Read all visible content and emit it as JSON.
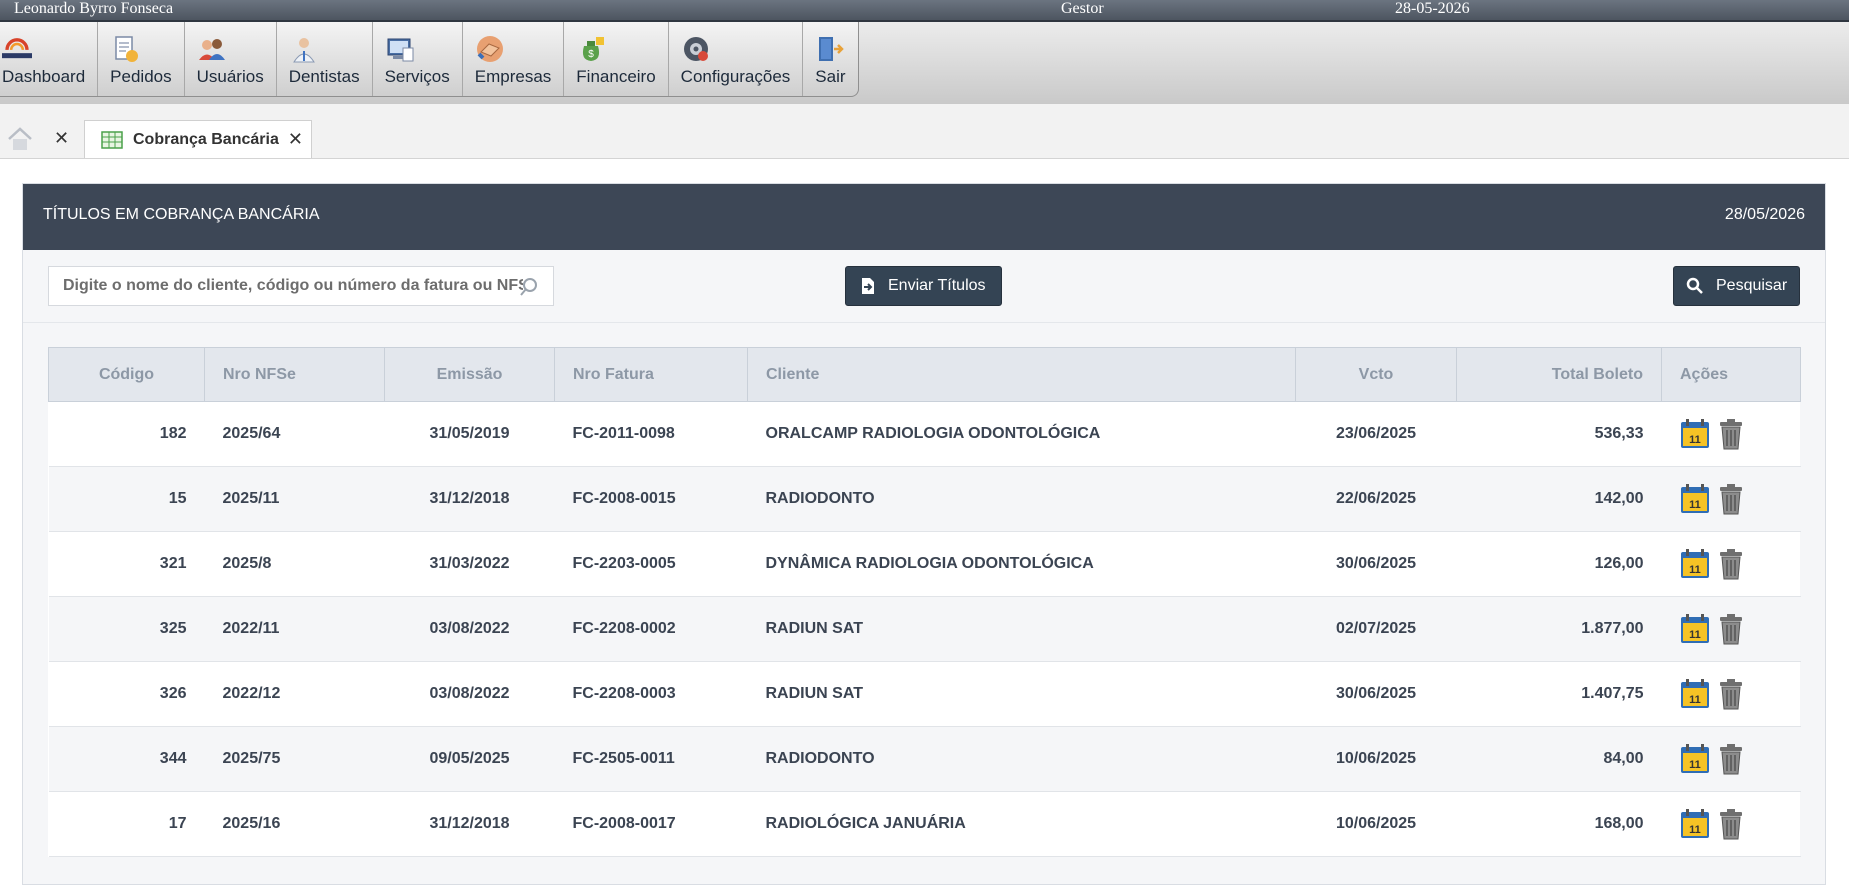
{
  "topbar": {
    "user": "Leonardo Byrro Fonseca",
    "role": "Gestor",
    "date": "28-05-2026"
  },
  "menu": [
    {
      "label": "Dashboard",
      "icon": "diagnosis-logo-icon"
    },
    {
      "label": "Pedidos",
      "icon": "orders-icon"
    },
    {
      "label": "Usuários",
      "icon": "users-icon"
    },
    {
      "label": "Dentistas",
      "icon": "dentist-icon"
    },
    {
      "label": "Serviços",
      "icon": "services-icon"
    },
    {
      "label": "Empresas",
      "icon": "handshake-icon"
    },
    {
      "label": "Financeiro",
      "icon": "money-bag-icon"
    },
    {
      "label": "Configurações",
      "icon": "settings-icon"
    },
    {
      "label": "Sair",
      "icon": "exit-door-icon"
    }
  ],
  "tabs": {
    "active_label": "Cobrança Bancária"
  },
  "panel": {
    "title": "TÍTULOS EM COBRANÇA BANCÁRIA",
    "date": "28/05/2026",
    "search_placeholder": "Digite o nome do cliente, código ou número da fatura ou NFSe",
    "send_label": "Enviar Títulos",
    "search_label": "Pesquisar"
  },
  "table": {
    "headers": [
      "Código",
      "Nro NFSe",
      "Emissão",
      "Nro Fatura",
      "Cliente",
      "Vcto",
      "Total Boleto",
      "Ações"
    ],
    "rows": [
      {
        "codigo": "182",
        "nfse": "2025/64",
        "emissao": "31/05/2019",
        "fatura": "FC-2011-0098",
        "cliente": "ORALCAMP RADIOLOGIA ODONTOLÓGICA",
        "vcto": "23/06/2025",
        "total": "536,33"
      },
      {
        "codigo": "15",
        "nfse": "2025/11",
        "emissao": "31/12/2018",
        "fatura": "FC-2008-0015",
        "cliente": "RADIODONTO",
        "vcto": "22/06/2025",
        "total": "142,00"
      },
      {
        "codigo": "321",
        "nfse": "2025/8",
        "emissao": "31/03/2022",
        "fatura": "FC-2203-0005",
        "cliente": "DYNÂMICA RADIOLOGIA ODONTOLÓGICA",
        "vcto": "30/06/2025",
        "total": "126,00"
      },
      {
        "codigo": "325",
        "nfse": "2022/11",
        "emissao": "03/08/2022",
        "fatura": "FC-2208-0002",
        "cliente": "RADIUN SAT",
        "vcto": "02/07/2025",
        "total": "1.877,00"
      },
      {
        "codigo": "326",
        "nfse": "2022/12",
        "emissao": "03/08/2022",
        "fatura": "FC-2208-0003",
        "cliente": "RADIUN SAT",
        "vcto": "30/06/2025",
        "total": "1.407,75"
      },
      {
        "codigo": "344",
        "nfse": "2025/75",
        "emissao": "09/05/2025",
        "fatura": "FC-2505-0011",
        "cliente": "RADIODONTO",
        "vcto": "10/06/2025",
        "total": "84,00"
      },
      {
        "codigo": "17",
        "nfse": "2025/16",
        "emissao": "31/12/2018",
        "fatura": "FC-2008-0017",
        "cliente": "RADIOLÓGICA JANUÁRIA",
        "vcto": "10/06/2025",
        "total": "168,00"
      }
    ],
    "action_icons": [
      "calendar-icon",
      "trash-icon"
    ],
    "calendar_day": "11"
  }
}
